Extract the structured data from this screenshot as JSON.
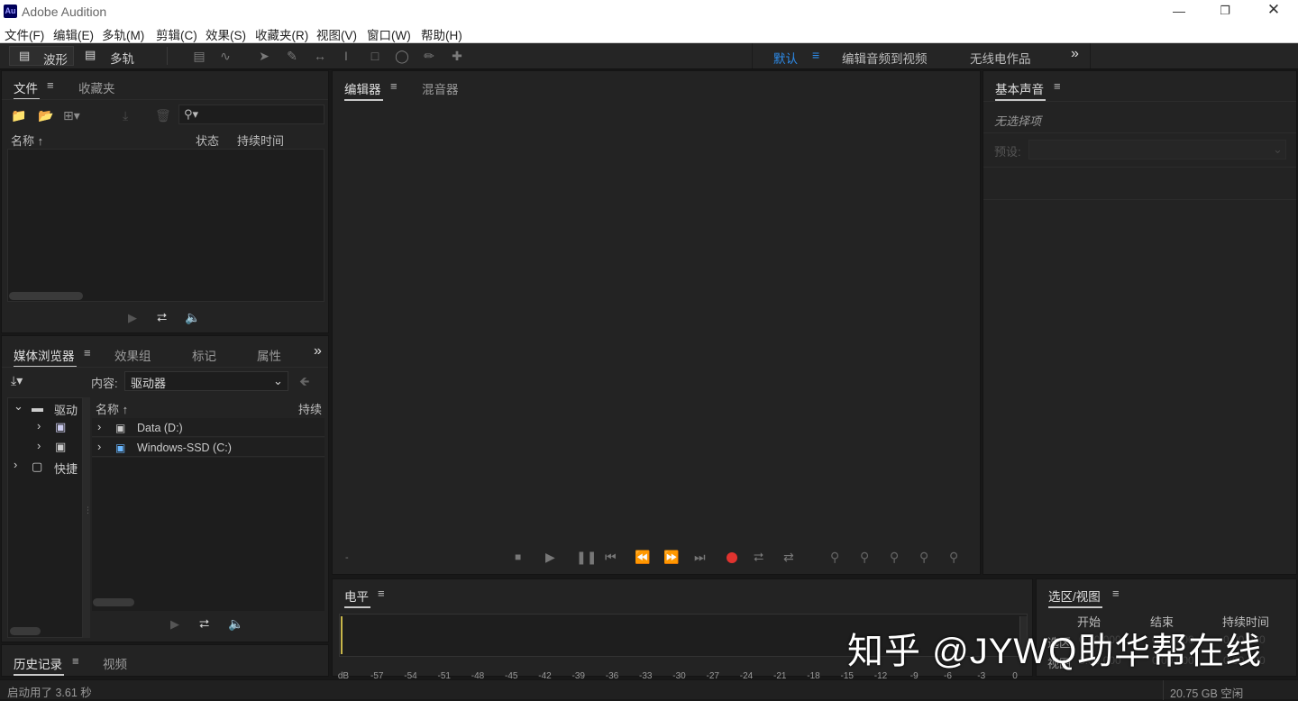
{
  "window": {
    "app_icon": "Au",
    "title": "Adobe Audition",
    "controls": [
      "minimize-icon",
      "restore-icon",
      "close-icon"
    ]
  },
  "menu": [
    "文件(F)",
    "编辑(E)",
    "多轨(M)",
    "剪辑(C)",
    "效果(S)",
    "收藏夹(R)",
    "视图(V)",
    "窗口(W)",
    "帮助(H)"
  ],
  "toolbar": {
    "waveform_label": "波形",
    "multitrack_label": "多轨",
    "workspaces": [
      "默认",
      "编辑音频到视频",
      "无线电作品"
    ],
    "active_workspace": "默认"
  },
  "files_panel": {
    "tabs": [
      "文件",
      "收藏夹"
    ],
    "search_placeholder": "",
    "columns": {
      "name": "名称",
      "status": "状态",
      "duration": "持续时间"
    }
  },
  "media_panel": {
    "tabs": [
      "媒体浏览器",
      "效果组",
      "标记",
      "属性"
    ],
    "content_label": "内容:",
    "content_value": "驱动器",
    "tree": [
      "驱动",
      "快捷"
    ],
    "column_name": "名称",
    "column_duration": "持续",
    "drives": [
      "Data (D:)",
      "Windows-SSD (C:)"
    ]
  },
  "history_panel": {
    "tabs": [
      "历史记录",
      "视频"
    ]
  },
  "editor_panel": {
    "tabs": [
      "编辑器",
      "混音器"
    ],
    "time_display": "-"
  },
  "essential_sound": {
    "title": "基本声音",
    "no_selection": "无选择项",
    "preset_label": "预设:"
  },
  "level_panel": {
    "title": "电平",
    "scale": [
      "dB",
      "-57",
      "-54",
      "-51",
      "-48",
      "-45",
      "-42",
      "-39",
      "-36",
      "-33",
      "-30",
      "-27",
      "-24",
      "-21",
      "-18",
      "-15",
      "-12",
      "-9",
      "-6",
      "-3",
      "0"
    ]
  },
  "selection_panel": {
    "title": "选区/视图",
    "columns": [
      "开始",
      "结束",
      "持续时间"
    ],
    "rows": [
      {
        "label": "选区",
        "start": "0:00.000",
        "end": "0:00.000",
        "duration": "0:00.000"
      },
      {
        "label": "视图",
        "start": "0:00.000",
        "end": "0:00.000",
        "duration": "0:00.000"
      }
    ]
  },
  "status_bar": {
    "left": "启动用了 3.61 秒",
    "right": "20.75 GB 空闲"
  },
  "watermark": "知乎 @JYWQ助华帮在线",
  "colors": {
    "accent": "#2d8ceb",
    "record": "#e0332f",
    "panel": "#232323"
  }
}
